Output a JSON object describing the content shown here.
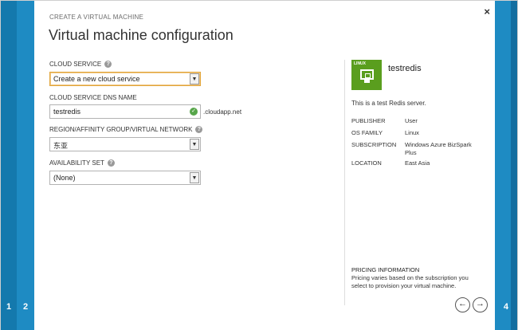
{
  "wizard": {
    "steps": [
      "1",
      "2",
      "4"
    ],
    "eyebrow": "CREATE A VIRTUAL MACHINE",
    "title": "Virtual machine configuration",
    "close_glyph": "×"
  },
  "form": {
    "cloud_service": {
      "label": "CLOUD SERVICE",
      "value": "Create a new cloud service"
    },
    "dns_name": {
      "label": "CLOUD SERVICE DNS NAME",
      "value": "testredis",
      "suffix": ".cloudapp.net"
    },
    "region": {
      "label": "REGION/AFFINITY GROUP/VIRTUAL NETWORK",
      "value": "东亚"
    },
    "availability_set": {
      "label": "AVAILABILITY SET",
      "value": "(None)"
    }
  },
  "summary": {
    "tile_tag": "LINUX",
    "tile_color": "#5a9e1e",
    "name": "testredis",
    "description": "This is a test Redis server.",
    "meta": [
      {
        "key": "PUBLISHER",
        "value": "User"
      },
      {
        "key": "OS FAMILY",
        "value": "Linux"
      },
      {
        "key": "SUBSCRIPTION",
        "value": "Windows Azure BizSpark Plus"
      },
      {
        "key": "LOCATION",
        "value": "East Asia"
      }
    ],
    "pricing_heading": "PRICING INFORMATION",
    "pricing_text": "Pricing varies based on the subscription you select to provision your virtual machine."
  },
  "nav": {
    "prev_glyph": "←",
    "next_glyph": "→"
  },
  "colors": {
    "accent": "#1e8bc3",
    "focus": "#e1a53a",
    "valid": "#57a64a"
  }
}
